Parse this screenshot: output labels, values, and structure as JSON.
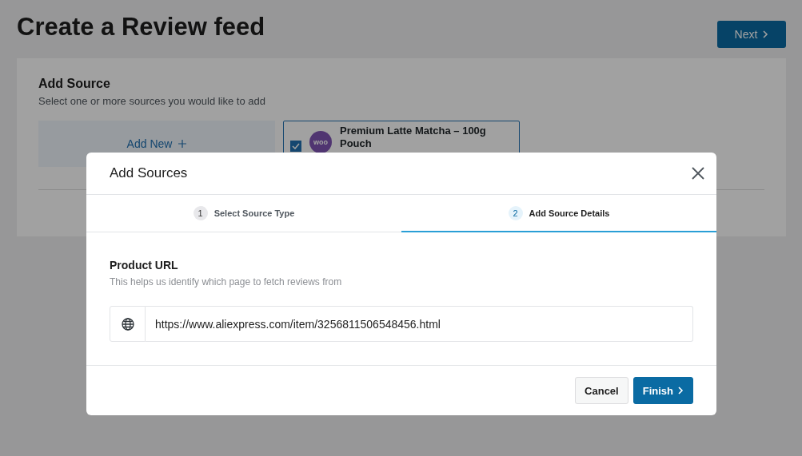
{
  "page": {
    "title": "Create a Review feed",
    "next_button": "Next"
  },
  "add_source": {
    "title": "Add Source",
    "subtitle": "Select one or more sources you would like to add",
    "add_new": "Add New",
    "sources": [
      {
        "name": "Premium Latte Matcha – 100g Pouch",
        "logo": "woo",
        "checked": true
      }
    ]
  },
  "modal": {
    "title": "Add Sources",
    "steps": [
      {
        "number": "1",
        "label": "Select Source Type",
        "selected": false
      },
      {
        "number": "2",
        "label": "Add Source Details",
        "selected": true
      }
    ],
    "field": {
      "label": "Product URL",
      "hint": "This helps us identify which page to fetch reviews from",
      "value": "https://www.aliexpress.com/item/3256811506548456.html"
    },
    "buttons": [
      {
        "label": "Cancel",
        "kind": "secondary"
      },
      {
        "label": "Finish",
        "kind": "primary"
      }
    ]
  }
}
